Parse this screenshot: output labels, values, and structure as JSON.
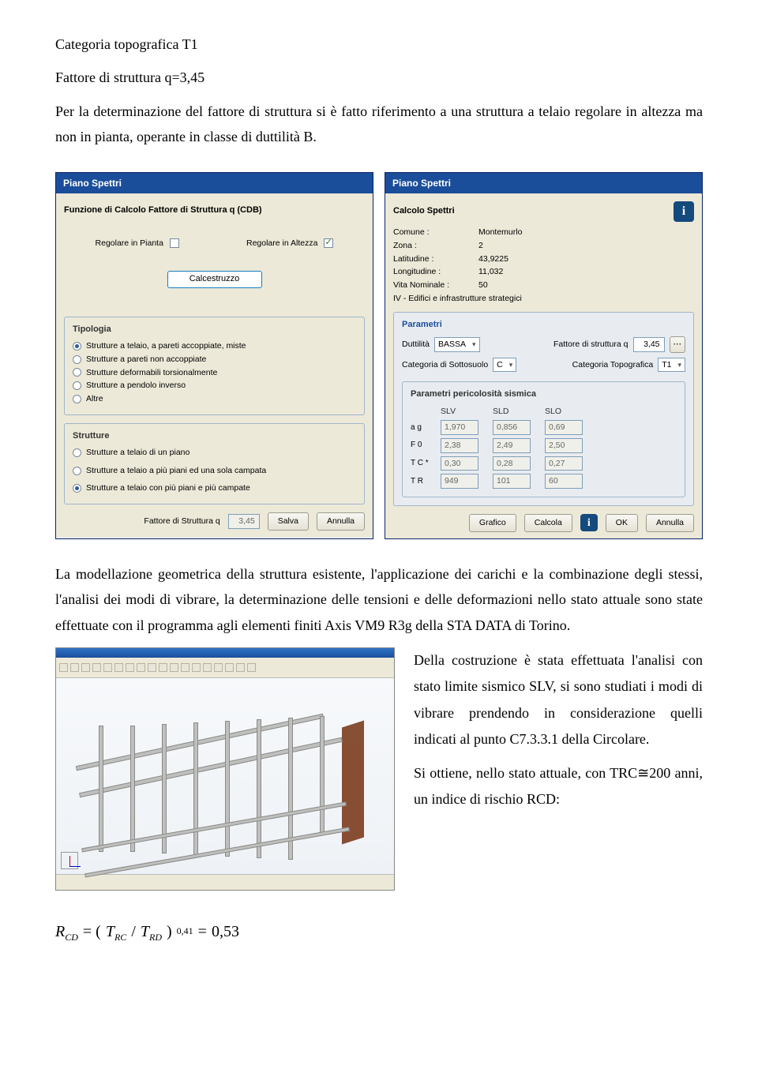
{
  "intro": {
    "p1": "Categoria topografica T1",
    "p2": "Fattore di struttura q=3,45",
    "p3": "Per la determinazione del fattore di struttura si è fatto riferimento a una struttura a telaio regolare in altezza ma non in pianta, operante in classe di duttilità B."
  },
  "dialog1": {
    "title": "Piano Spettri",
    "sub": "Funzione di Calcolo Fattore di Struttura q (CDB)",
    "reg_pianta": "Regolare in Pianta",
    "reg_altezza": "Regolare in Altezza",
    "material": "Calcestruzzo",
    "tipologia_h": "Tipologia",
    "t1": "Strutture a telaio, a pareti accoppiate, miste",
    "t2": "Strutture a pareti non accoppiate",
    "t3": "Strutture deformabili torsionalmente",
    "t4": "Strutture a pendolo inverso",
    "t5": "Altre",
    "strutture_h": "Strutture",
    "s1": "Strutture a telaio di un piano",
    "s2": "Strutture a telaio a più piani ed una sola campata",
    "s3": "Strutture a telaio con più piani e più campate",
    "fattore_lbl": "Fattore di Struttura q",
    "fattore_val": "3,45",
    "btn_salva": "Salva",
    "btn_annulla": "Annulla"
  },
  "dialog2": {
    "title": "Piano Spettri",
    "sub": "Calcolo Spettri",
    "kv": {
      "comune_l": "Comune :",
      "comune_v": "Montemurlo",
      "zona_l": "Zona :",
      "zona_v": "2",
      "lat_l": "Latitudine :",
      "lat_v": "43,9225",
      "lon_l": "Longitudine :",
      "lon_v": "11,032",
      "vita_l": "Vita Nominale :",
      "vita_v": "50",
      "edif": "IV - Edifici e infrastrutture strategici"
    },
    "param_h": "Parametri",
    "dutt_l": "Duttilità",
    "dutt_v": "BASSA",
    "fq_l": "Fattore di struttura q",
    "fq_v": "3,45",
    "cat_ss_l": "Categoria di Sottosuolo",
    "cat_ss_v": "C",
    "cat_tp_l": "Categoria Topografica",
    "cat_tp_v": "T1",
    "pps_h": "Parametri pericolosità sismica",
    "cols": {
      "c0": "",
      "c1": "SLV",
      "c2": "SLD",
      "c3": "SLO"
    },
    "rows": {
      "ag_l": "a g",
      "ag": [
        "1,970",
        "0,856",
        "0,69"
      ],
      "f0_l": "F 0",
      "f0": [
        "2,38",
        "2,49",
        "2,50"
      ],
      "tc_l": "T C *",
      "tc": [
        "0,30",
        "0,28",
        "0,27"
      ],
      "tr_l": "T R",
      "tr": [
        "949",
        "101",
        "60"
      ]
    },
    "btns": {
      "grafico": "Grafico",
      "calcola": "Calcola",
      "ok": "OK",
      "annulla": "Annulla"
    }
  },
  "mid": {
    "p1": "La modellazione geometrica della struttura esistente, l'applicazione dei carichi e la combinazione degli stessi, l'analisi dei modi di vibrare, la determinazione delle tensioni e delle deformazioni nello stato attuale sono state effettuate con il programma agli elementi finiti Axis VM9 R3g della STA DATA di Torino."
  },
  "right": {
    "p1": "Della costruzione è stata effettuata l'analisi con stato limite sismico SLV, si sono studiati i modi di vibrare prendendo in considerazione quelli indicati al punto C7.3.3.1 della Circolare.",
    "p2": "Si ottiene, nello stato attuale, con TRC≅200 anni, un indice di rischio RCD:"
  },
  "formula": {
    "lhs_R": "R",
    "lhs_CD": "CD",
    "eq1": "= (",
    "T1": "T",
    "RC": "RC",
    "slash": " / ",
    "T2": "T",
    "RD": "RD",
    "close": ")",
    "exp": "0,41",
    "eq2": " = ",
    "val": "0,53"
  }
}
